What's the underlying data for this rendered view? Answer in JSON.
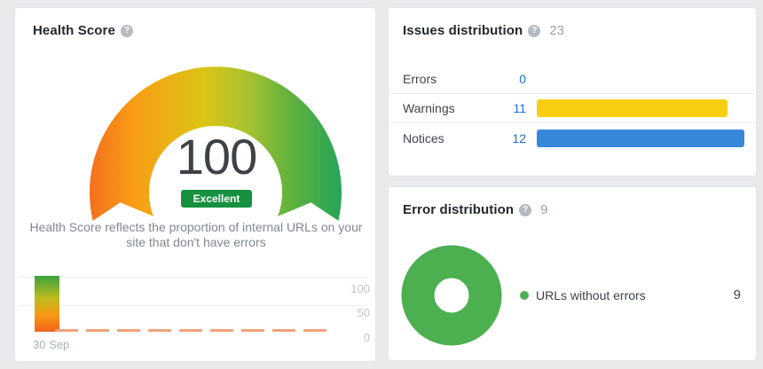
{
  "icons": {
    "help_glyph": "?"
  },
  "health_card": {
    "title": "Health Score",
    "score": "100",
    "score_label": "Excellent",
    "description_lines": [
      "Health Score reflects the proportion of internal URLs on your",
      "site that don't have errors"
    ],
    "trend": {
      "ytick_labels": [
        "100",
        "50",
        "0"
      ],
      "xtick_label": "30 Sep"
    }
  },
  "issues_card": {
    "title": "Issues distribution",
    "total": "23",
    "bar_scale_max": 12,
    "rows": [
      {
        "label": "Errors",
        "value": 0,
        "value_text": "0",
        "bar_color": null
      },
      {
        "label": "Warnings",
        "value": 11,
        "value_text": "11",
        "bar_color": "#f7ce11"
      },
      {
        "label": "Notices",
        "value": 12,
        "value_text": "12",
        "bar_color": "#3787db"
      }
    ]
  },
  "error_card": {
    "title": "Error distribution",
    "total": "9",
    "legend": {
      "label": "URLs without errors",
      "value": "9",
      "color": "#4caf50"
    }
  },
  "colors": {
    "badge_green": "#15913f",
    "link_blue": "#1c6fd6",
    "warning_yellow": "#f7ce11",
    "notice_blue": "#3787db",
    "donut_green": "#4caf50",
    "gauge_gradient": [
      "#f4701d",
      "#f89e15",
      "#dcc414",
      "#abc32f",
      "#5fb13d",
      "#27a45b"
    ]
  },
  "chart_data": [
    {
      "type": "gauge",
      "title": "Health Score",
      "value": 100,
      "min": 0,
      "max": 100,
      "status_label": "Excellent",
      "colors": [
        "#f4701d",
        "#f89e15",
        "#dcc414",
        "#abc32f",
        "#5fb13d",
        "#27a45b"
      ]
    },
    {
      "type": "bar",
      "title": "Health Score trend",
      "categories": [
        "30 Sep"
      ],
      "values": [
        100
      ],
      "ylim": [
        0,
        100
      ],
      "yticks": [
        0,
        50,
        100
      ],
      "grid": true,
      "note": "single gradient bar at 100; dashed orange zero-line placeholders for future dates"
    },
    {
      "type": "bar",
      "title": "Issues distribution",
      "orientation": "horizontal",
      "categories": [
        "Errors",
        "Warnings",
        "Notices"
      ],
      "values": [
        0,
        11,
        12
      ],
      "total": 23,
      "colors": [
        null,
        "#f7ce11",
        "#3787db"
      ]
    },
    {
      "type": "pie",
      "title": "Error distribution",
      "total": 9,
      "slices": [
        {
          "label": "URLs without errors",
          "value": 9,
          "color": "#4caf50"
        }
      ],
      "legend_position": "right",
      "donut": true
    }
  ]
}
